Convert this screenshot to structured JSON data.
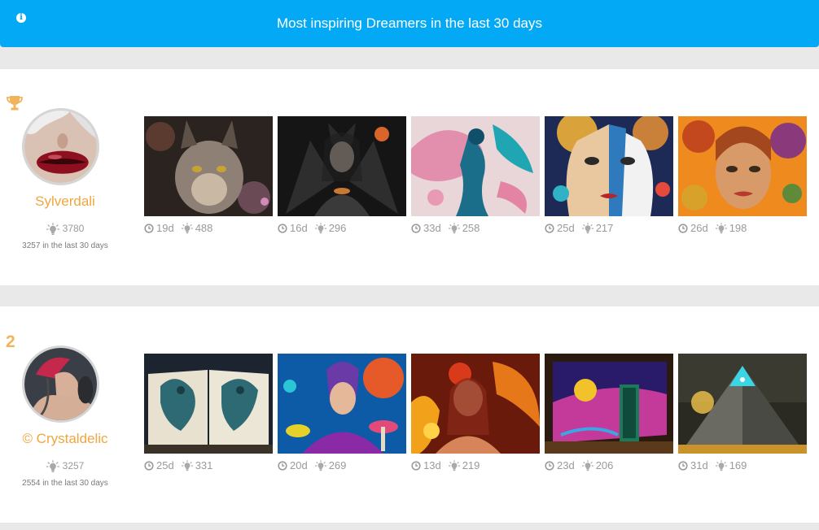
{
  "header": {
    "title": "Most inspiring Dreamers in the last 30 days"
  },
  "leaderboard": [
    {
      "rank_icon": "trophy-icon",
      "name": "Sylverdali",
      "total_likes": "3780",
      "recent_likes": "3257 in the last 30 days",
      "dreams": [
        {
          "age": "19d",
          "likes": "488",
          "subject": "fantasy cat portrait"
        },
        {
          "age": "16d",
          "likes": "296",
          "subject": "dark winged woman"
        },
        {
          "age": "33d",
          "likes": "258",
          "subject": "pink ink swirl figure"
        },
        {
          "age": "25d",
          "likes": "217",
          "subject": "cubist face painting"
        },
        {
          "age": "26d",
          "likes": "198",
          "subject": "floral face portrait"
        }
      ]
    },
    {
      "rank": "2",
      "name": "© Crystaldelic",
      "total_likes": "3257",
      "recent_likes": "2554 in the last 30 days",
      "dreams": [
        {
          "age": "25d",
          "likes": "331",
          "subject": "dragon book"
        },
        {
          "age": "20d",
          "likes": "269",
          "subject": "mushroom fairy"
        },
        {
          "age": "13d",
          "likes": "219",
          "subject": "fire phoenix woman"
        },
        {
          "age": "23d",
          "likes": "206",
          "subject": "painted gallery door"
        },
        {
          "age": "31d",
          "likes": "169",
          "subject": "glowing pyramid"
        }
      ]
    }
  ],
  "colors": {
    "banner": "#03a9f4",
    "accent": "#f0a63e",
    "muted": "#9a9a9a"
  }
}
